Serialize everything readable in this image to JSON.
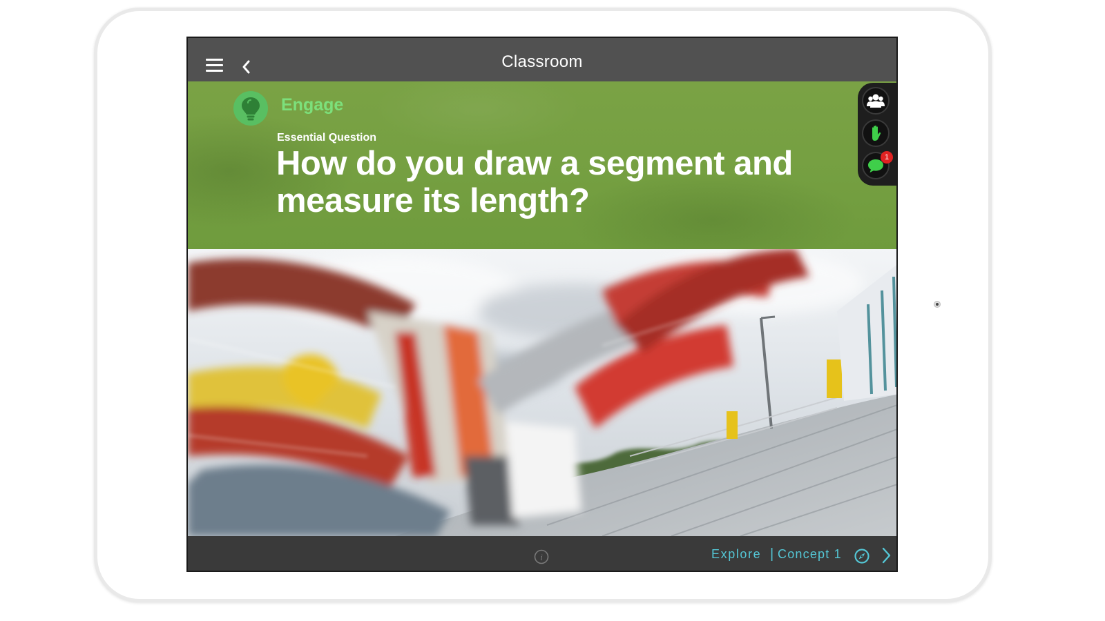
{
  "app": {
    "title": "Classroom"
  },
  "topbar": {
    "menu_icon": "hamburger-menu-icon",
    "back_icon": "chevron-left-icon"
  },
  "banner": {
    "icon": "lightbulb-icon",
    "section": "Engage",
    "eyebrow": "Essential Question",
    "question": "How do you draw a segment and measure its length?",
    "color": "#76a042",
    "section_color": "#7ce07b"
  },
  "tools": {
    "items": [
      {
        "icon": "group-icon"
      },
      {
        "icon": "raise-hand-icon"
      },
      {
        "icon": "chat-bubble-icon",
        "badge": "1"
      }
    ],
    "badge_color": "#e02222"
  },
  "photo": {
    "description_icon": "amusement-ride-photo"
  },
  "bottombar": {
    "info_icon": "info-icon",
    "next_section": "Explore",
    "separator": "|",
    "concept": "Concept 1",
    "compass_icon": "compass-icon",
    "next_icon": "chevron-right-icon",
    "accent": "#54c7d6"
  }
}
